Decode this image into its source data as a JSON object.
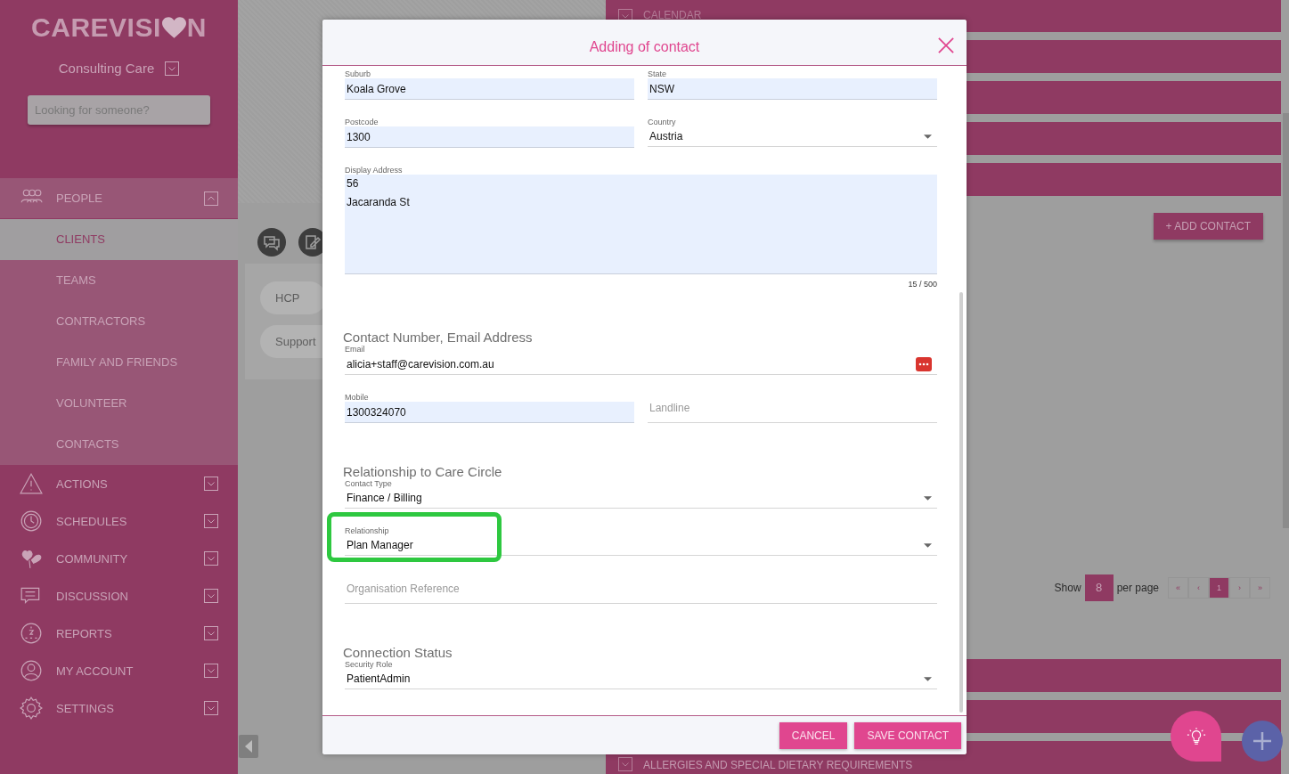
{
  "sidebar": {
    "logo": {
      "before": "CAREVISI",
      "after": "N"
    },
    "organisation": "Consulting Care",
    "search": {
      "placeholder": "Looking for someone?"
    },
    "items": [
      {
        "label": "PEOPLE",
        "expanded": true,
        "children": [
          {
            "label": "CLIENTS",
            "selected": true
          },
          {
            "label": "TEAMS",
            "selected": false
          },
          {
            "label": "CONTRACTORS",
            "selected": false
          },
          {
            "label": "FAMILY AND FRIENDS",
            "selected": false
          },
          {
            "label": "VOLUNTEER",
            "selected": false
          },
          {
            "label": "CONTACTS",
            "selected": false
          }
        ]
      },
      {
        "label": "ACTIONS",
        "expanded": false
      },
      {
        "label": "SCHEDULES",
        "expanded": false
      },
      {
        "label": "COMMUNITY",
        "expanded": false
      },
      {
        "label": "DISCUSSION",
        "expanded": false
      },
      {
        "label": "REPORTS",
        "expanded": false
      },
      {
        "label": "MY ACCOUNT",
        "expanded": false
      },
      {
        "label": "SETTINGS",
        "expanded": false
      }
    ]
  },
  "background": {
    "top_section": "CALENDAR",
    "tags": [
      "HCP",
      "Support"
    ],
    "add_button": "+ ADD CONTACT",
    "pagination": {
      "show": "Show",
      "per_page_value": "8",
      "per_page": "per page",
      "pages": [
        {
          "label": "«",
          "selected": false
        },
        {
          "label": "‹",
          "selected": false
        },
        {
          "label": "1",
          "selected": true
        },
        {
          "label": "›",
          "selected": false
        },
        {
          "label": "»",
          "selected": false
        }
      ]
    },
    "bottom_section": "ALLERGIES AND SPECIAL DIETARY REQUIREMENTS"
  },
  "dialog": {
    "title": "Adding of contact",
    "sections": [
      {
        "rows": [
          [
            {
              "label": "Suburb",
              "kind": "text",
              "value": "Koala Grove",
              "autofilled": true
            },
            {
              "label": "State",
              "kind": "text",
              "value": "NSW",
              "autofilled": true
            }
          ],
          [
            {
              "label": "Postcode",
              "kind": "text",
              "value": "1300",
              "autofilled": true
            },
            {
              "label": "Country",
              "kind": "select",
              "value": "Austria"
            }
          ],
          [
            {
              "label": "Display Address",
              "kind": "textarea",
              "value": "56\nJacaranda St",
              "autofilled": true,
              "counter": "15 / 500"
            }
          ]
        ]
      },
      {
        "heading": "Contact Number, Email Address",
        "rows": [
          [
            {
              "label": "Email",
              "kind": "text",
              "value": "alicia+staff@carevision.com.au",
              "trailing_icon": true
            }
          ],
          [
            {
              "label": "Mobile",
              "kind": "text",
              "value": "1300324070",
              "autofilled": true
            },
            {
              "kind": "text",
              "placeholder": "Landline"
            }
          ]
        ]
      },
      {
        "heading": "Relationship to Care Circle",
        "rows": [
          [
            {
              "label": "Contact Type",
              "kind": "select",
              "value": "Finance / Billing"
            }
          ],
          [
            {
              "label": "Relationship",
              "kind": "select",
              "value": "Plan Manager",
              "highlighted": true
            }
          ],
          [
            {
              "kind": "text",
              "placeholder": "Organisation Reference"
            }
          ]
        ]
      },
      {
        "heading": "Connection Status",
        "rows": [
          [
            {
              "label": "Security Role",
              "kind": "select",
              "value": "PatientAdmin"
            }
          ]
        ]
      }
    ],
    "buttons": [
      "CANCEL",
      "SAVE CONTACT"
    ]
  }
}
